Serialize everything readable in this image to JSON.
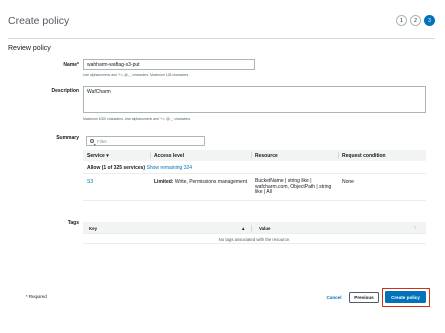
{
  "page": {
    "title": "Create policy",
    "steps": [
      "1",
      "2",
      "3"
    ],
    "active_step": 3
  },
  "review": {
    "section_title": "Review policy",
    "name_label": "Name*",
    "name_value": "wahharm-waftag-s3-put",
    "name_hint": "Use alphanumeric and '+=,.@-_' characters. Maximum 128 characters.",
    "description_label": "Description",
    "description_value": "WafCharm",
    "description_hint": "Maximum 1000 characters. Use alphanumeric and '+=,.@-_' characters."
  },
  "summary": {
    "label": "Summary",
    "filter_placeholder": "Filter",
    "columns": [
      "Service",
      "Access level",
      "Resource",
      "Request condition"
    ],
    "sort_indicator": "▾",
    "group_text": "Allow (1 of 325 services)",
    "group_link": "Show remaining 324",
    "rows": [
      {
        "service": "S3",
        "access_level_bold": "Limited:",
        "access_level_rest": " Write, Permissions management",
        "resource_line1": "BucketName | string like |",
        "resource_line2": "wafcharm.com, ObjectPath | string",
        "resource_line3": "like | All",
        "condition": "None"
      }
    ]
  },
  "tags": {
    "label": "Tags",
    "columns": [
      "Key",
      "Value"
    ],
    "empty_text": "No tags associated with the resource."
  },
  "footer": {
    "required_note": "* Required",
    "cancel_label": "Cancel",
    "previous_label": "Previous",
    "create_label": "Create policy"
  },
  "colors": {
    "accent": "#0073bb",
    "highlight": "#d13212"
  }
}
